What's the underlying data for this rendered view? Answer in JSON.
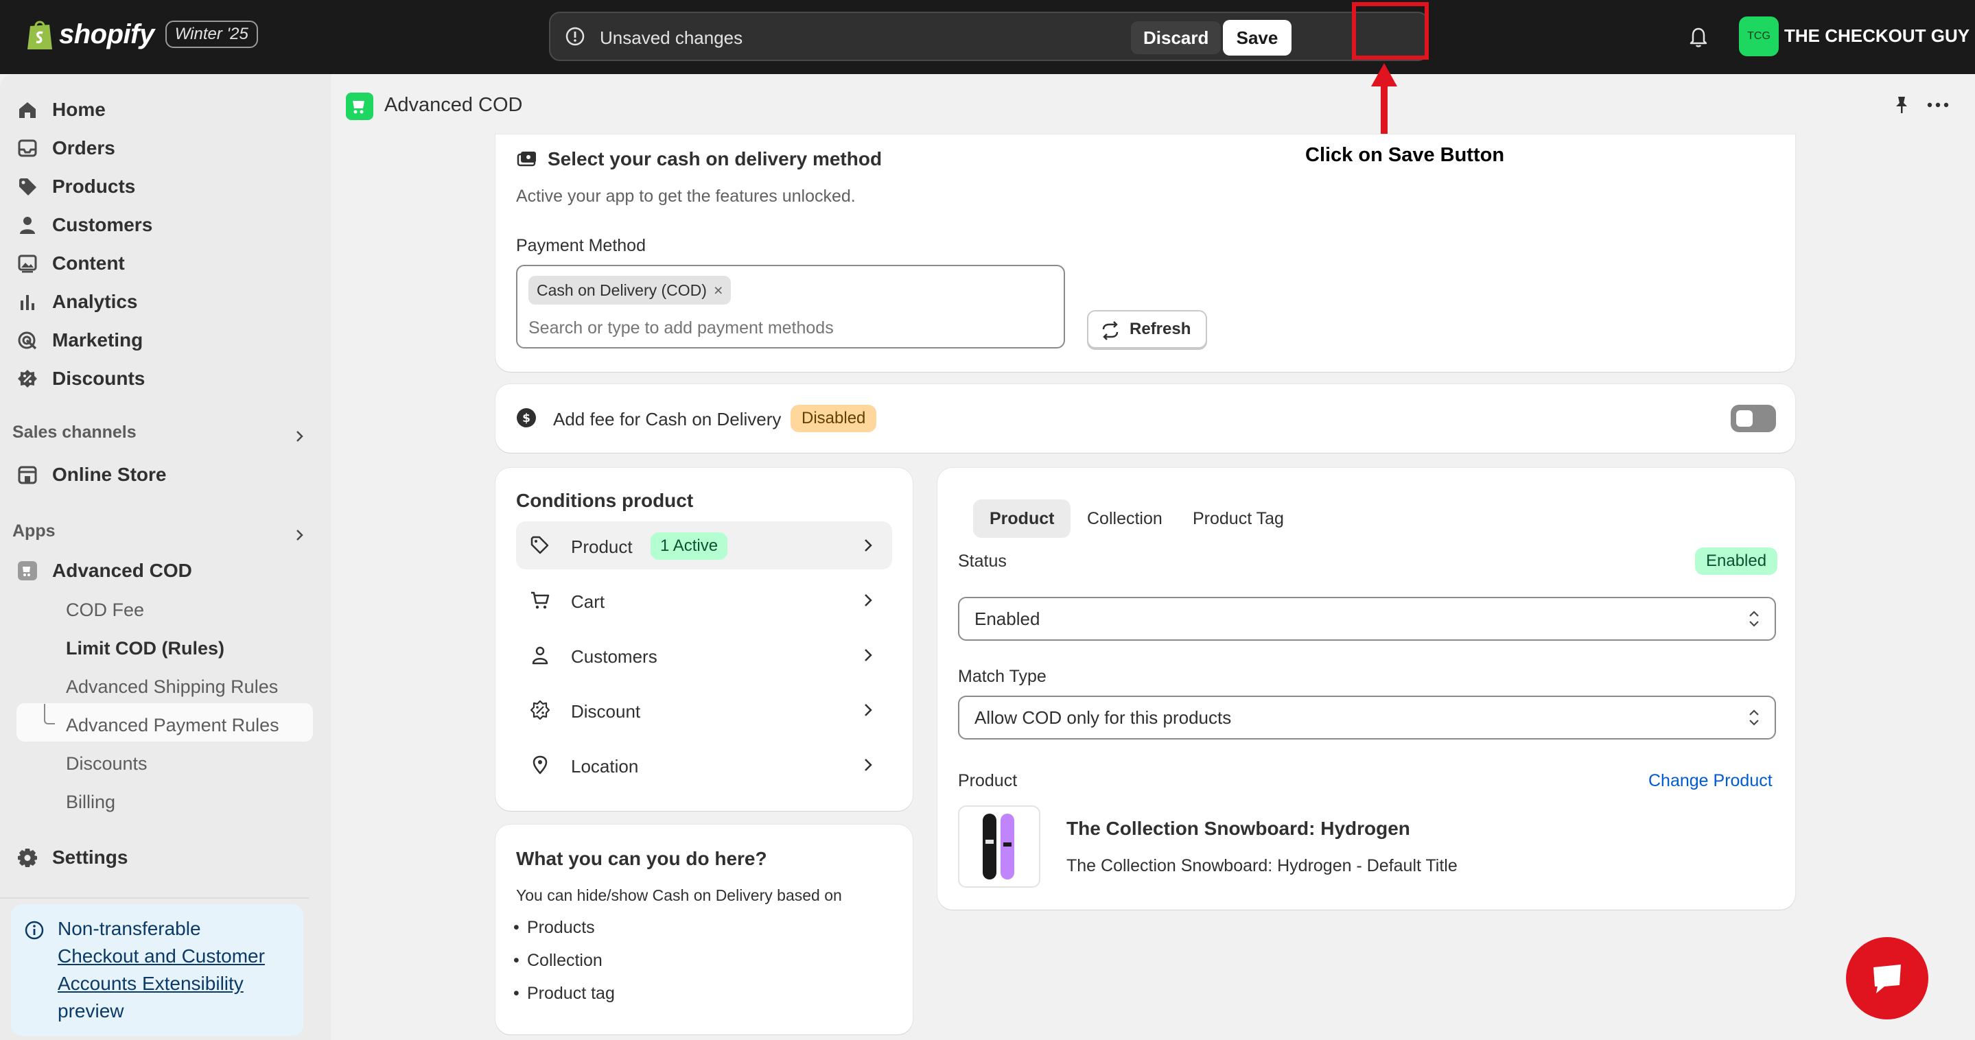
{
  "topbar": {
    "brand": "shopify",
    "edition_badge": "Winter '25",
    "unsaved_text": "Unsaved changes",
    "discard_label": "Discard",
    "save_label": "Save",
    "store_initials": "TCG",
    "store_name": "THE CHECKOUT GUY"
  },
  "sidebar": {
    "items": [
      {
        "label": "Home",
        "icon": "home-icon"
      },
      {
        "label": "Orders",
        "icon": "inbox-icon"
      },
      {
        "label": "Products",
        "icon": "tag-icon"
      },
      {
        "label": "Customers",
        "icon": "person-icon"
      },
      {
        "label": "Content",
        "icon": "image-icon"
      },
      {
        "label": "Analytics",
        "icon": "bar-chart-icon"
      },
      {
        "label": "Marketing",
        "icon": "target-icon"
      },
      {
        "label": "Discounts",
        "icon": "discount-icon"
      }
    ],
    "sales_channels_label": "Sales channels",
    "online_store_label": "Online Store",
    "apps_label": "Apps",
    "app_name": "Advanced COD",
    "app_sub_items": [
      "COD Fee",
      "Limit COD (Rules)",
      "Advanced Shipping Rules",
      "Advanced Payment Rules",
      "Discounts",
      "Billing"
    ],
    "settings_label": "Settings",
    "notice": {
      "line1": "Non-transferable",
      "link": "Checkout and Customer Accounts Extensibility",
      "line3": "preview"
    }
  },
  "page": {
    "title": "Advanced COD"
  },
  "payment_card": {
    "title": "Select your cash on delivery method",
    "subtitle": "Active your app to get the features unlocked.",
    "field_label": "Payment Method",
    "chip": "Cash on Delivery (COD)",
    "chip_remove": "×",
    "placeholder": "Search or type to add payment methods",
    "refresh_label": "Refresh"
  },
  "annotation": {
    "note": "Click on Save Button",
    "highlight_color": "#e0141e"
  },
  "fee_card": {
    "title": "Add fee for Cash on Delivery",
    "badge": "Disabled",
    "toggle_on": false
  },
  "conditions": {
    "title": "Conditions product",
    "rows": [
      {
        "label": "Product",
        "icon": "tag-icon",
        "badge": "1 Active"
      },
      {
        "label": "Cart",
        "icon": "cart-icon",
        "badge": ""
      },
      {
        "label": "Customers",
        "icon": "person-icon",
        "badge": ""
      },
      {
        "label": "Discount",
        "icon": "discount-icon",
        "badge": ""
      },
      {
        "label": "Location",
        "icon": "location-icon",
        "badge": ""
      }
    ]
  },
  "help_card": {
    "title": "What you can you do here?",
    "subtitle": "You can hide/show Cash on Delivery based on",
    "bullets": [
      "Products",
      "Collection",
      "Product tag"
    ]
  },
  "rule_card": {
    "tabs": [
      "Product",
      "Collection",
      "Product Tag"
    ],
    "active_tab": "Product",
    "status_label": "Status",
    "status_badge": "Enabled",
    "status_value": "Enabled",
    "match_label": "Match Type",
    "match_value": "Allow COD only for this products",
    "product_label": "Product",
    "change_link": "Change Product",
    "product_name": "The Collection Snowboard: Hydrogen",
    "product_variant": "The Collection Snowboard: Hydrogen - Default Title"
  },
  "colors": {
    "topbar_bg": "#1a1a1a",
    "accent_green": "#1ed760",
    "link_blue": "#005bd3",
    "chat_red": "#e0141e"
  }
}
